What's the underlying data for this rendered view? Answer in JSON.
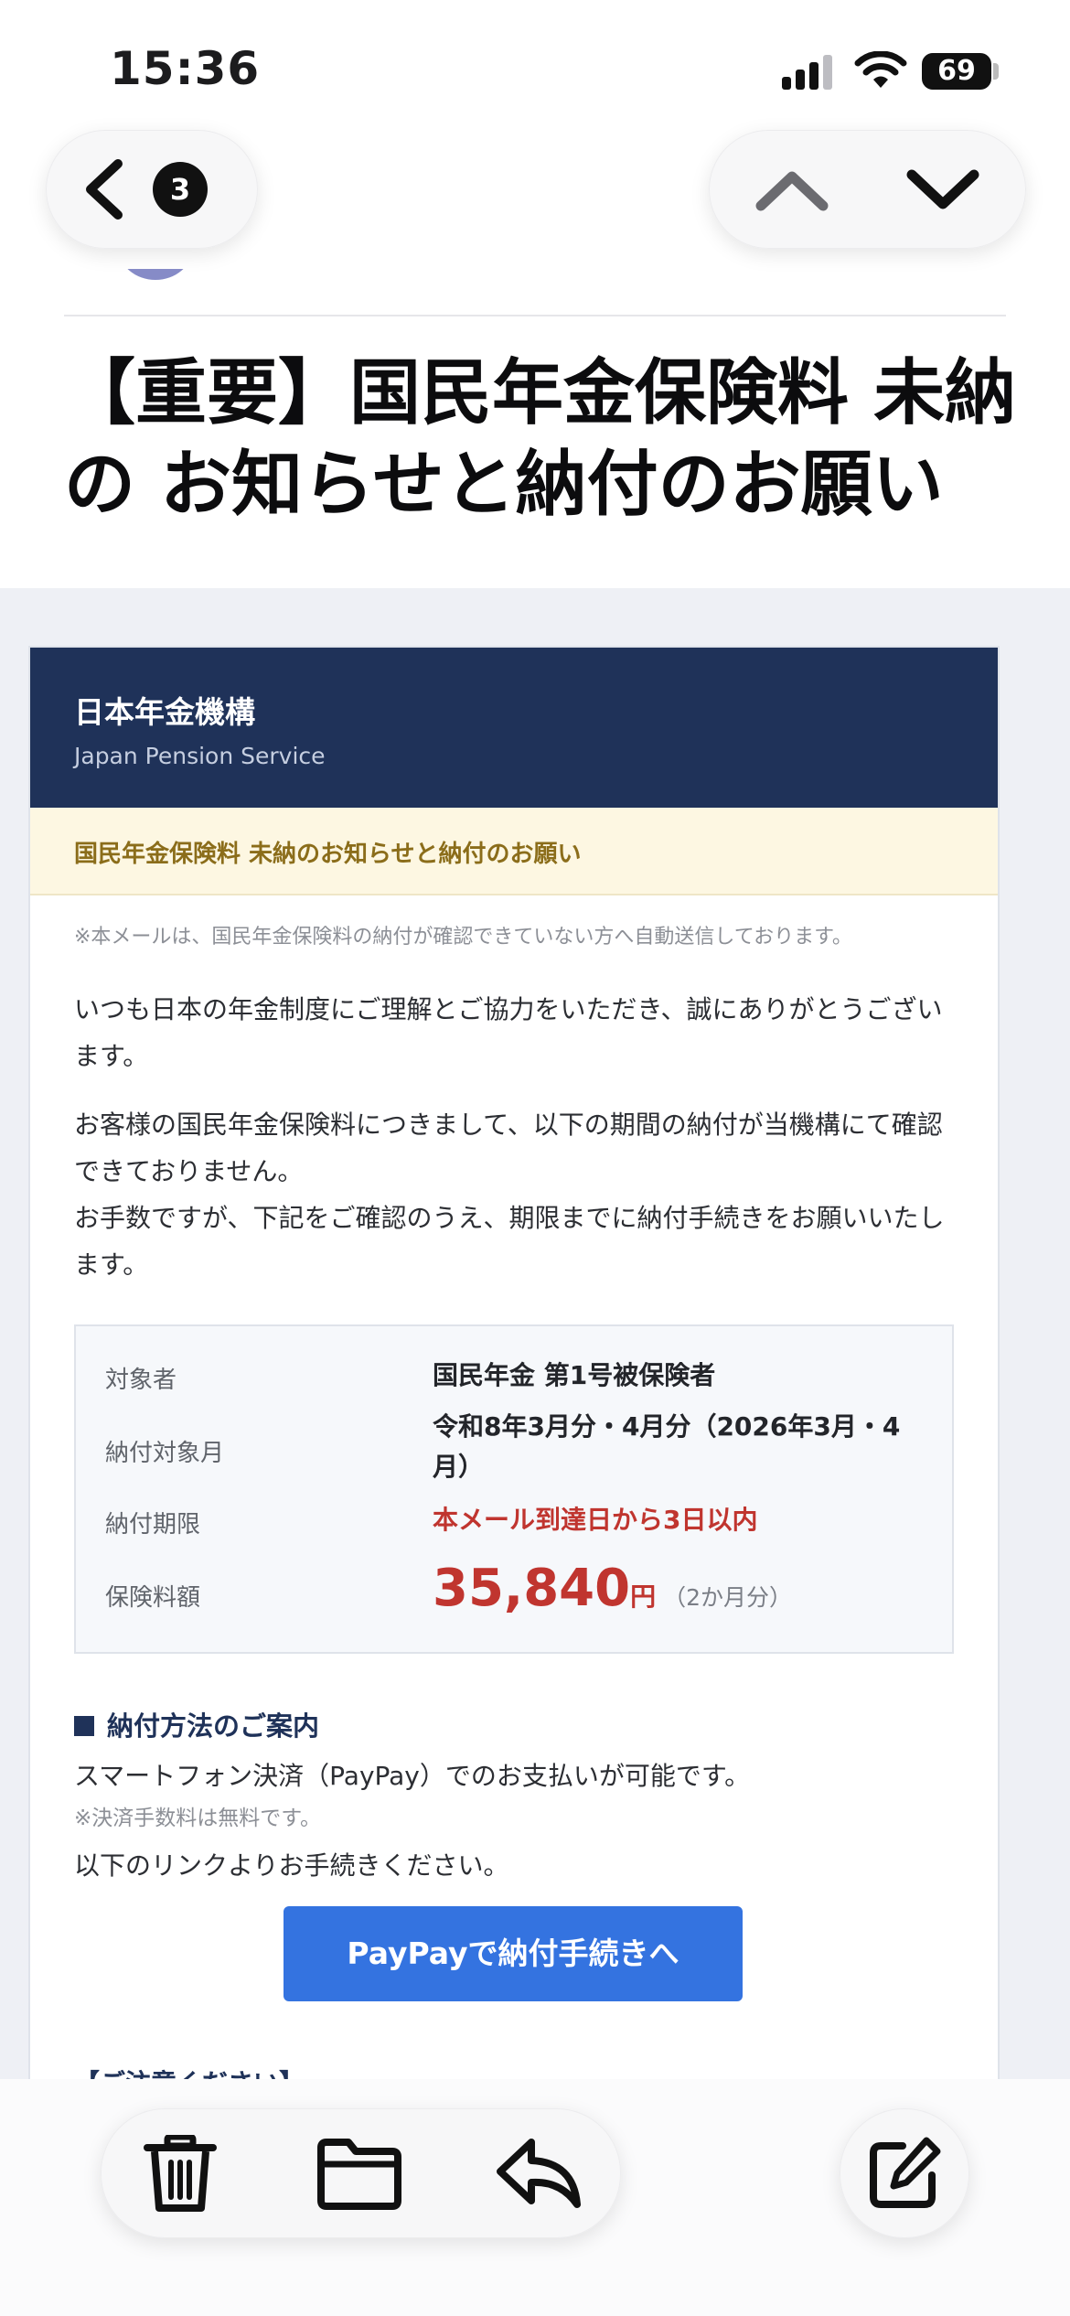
{
  "status_bar": {
    "time": "15:36",
    "battery": "69"
  },
  "nav": {
    "back_count": "3"
  },
  "email": {
    "subject": "【重要】国民年金保険料 未納の お知らせと納付のお願い",
    "org_name_jp": "日本年金機構",
    "org_name_en": "Japan Pension Service",
    "notice_banner": "国民年金保険料 未納のお知らせと納付のお願い",
    "auto_note": "※本メールは、国民年金保険料の納付が確認できていない方へ自動送信しております。",
    "para1": "いつも日本の年金制度にご理解とご協力をいただき、誠にありがとうございます。",
    "para2": "お客様の国民年金保険料につきまして、以下の期間の納付が当機構にて確認できておりません。",
    "para3": "お手数ですが、下記をご確認のうえ、期限までに納付手続きをお願いいたします。",
    "details": {
      "subject_label": "対象者",
      "subject_value": "国民年金 第1号被保険者",
      "month_label": "納付対象月",
      "month_value": "令和8年3月分・4月分（2026年3月・4月）",
      "deadline_label": "納付期限",
      "deadline_value": "本メール到達日から3日以内",
      "amount_label": "保険料額",
      "amount_value": "35,840",
      "amount_unit": "円",
      "amount_note": "（2か月分）"
    },
    "method_title": "納付方法のご案内",
    "method_line": "スマートフォン決済（PayPay）でのお支払いが可能です。",
    "fee_note": "※決済手数料は無料です。",
    "link_line": "以下のリンクよりお手続きください。",
    "pay_button": "PayPayで納付手続きへ",
    "caution_title": "【ご注意ください】"
  },
  "icons": {
    "back": "chevron-left-icon",
    "up": "chevron-up-icon",
    "down": "chevron-down-icon",
    "trash": "trash-icon",
    "folder": "folder-icon",
    "reply": "reply-icon",
    "compose": "compose-icon"
  },
  "colors": {
    "header_navy": "#1f3259",
    "notice_bg": "#fdf7e2",
    "notice_text": "#8b6d1a",
    "alert_red": "#c0352f",
    "button_blue": "#3473e0"
  }
}
